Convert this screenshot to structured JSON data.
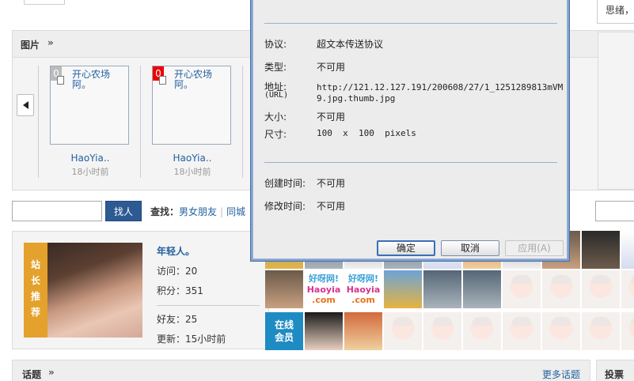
{
  "top": {
    "right_fragment": "思绪，"
  },
  "photo_panel": {
    "title": "图片",
    "arrow": "»",
    "items": [
      {
        "badge": "0",
        "caption": "开心农场阿。",
        "user": "HaoYia..",
        "time": "18小时前"
      },
      {
        "badge": "0",
        "caption": "开心农场阿。",
        "user": "HaoYia..",
        "time": "18小时前"
      }
    ]
  },
  "search": {
    "placeholder": "",
    "button": "找人",
    "label": "查找：",
    "links": [
      "男女朋友",
      "同城"
    ]
  },
  "recommend": {
    "ribbon": [
      "站",
      "长",
      "推",
      "荐"
    ],
    "name": "年轻人。",
    "visits": "访问：20",
    "points": "积分：351",
    "friends": "好友：25",
    "updated": "更新：15小时前"
  },
  "online": {
    "label_line1": "在线",
    "label_line2": "会员"
  },
  "haoyia_logo": {
    "line1": "好呀网!",
    "line2": "Haoyia",
    "line3": ".com"
  },
  "topic_bar": {
    "title": "话题",
    "arrow": "»",
    "more": "更多话题"
  },
  "vote_bar": {
    "title": "投票"
  },
  "dialog": {
    "rows": [
      {
        "label": "协议:",
        "value": "超文本传送协议"
      },
      {
        "label": "类型:",
        "value": "不可用"
      },
      {
        "label": "地址:",
        "label2": "(URL)",
        "value": "http://121.12.127.191/200608/27/1_1251289813mVM",
        "value2": "9.jpg.thumb.jpg"
      },
      {
        "label": "大小:",
        "value": "不可用"
      },
      {
        "label": "尺寸:",
        "value": "100  x  100  pixels"
      },
      {
        "label": "创建时间:",
        "value": "不可用"
      },
      {
        "label": "修改时间:",
        "value": "不可用"
      }
    ],
    "ok": "确定",
    "cancel": "取消",
    "apply": "应用(A)"
  }
}
